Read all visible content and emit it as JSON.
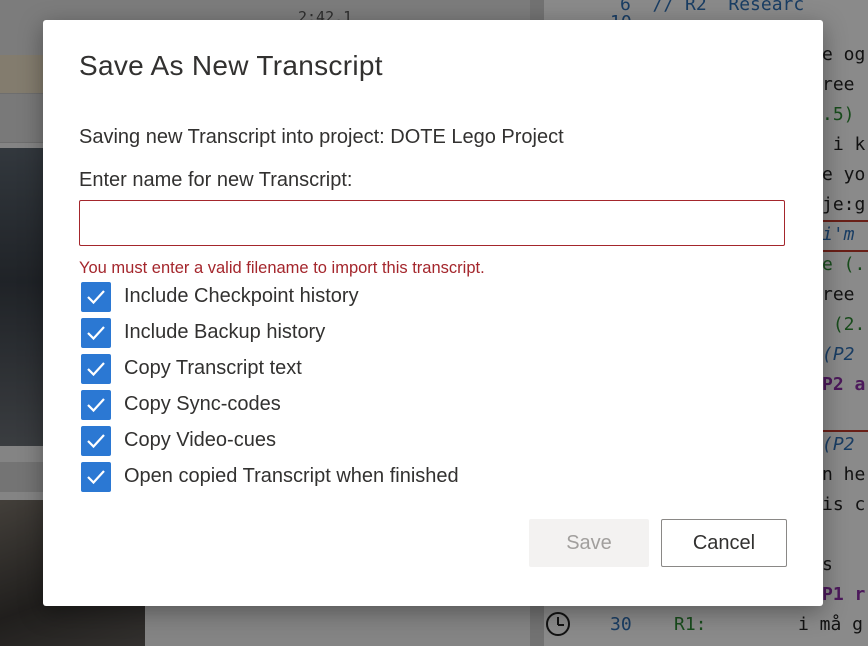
{
  "background": {
    "timestamp": "2:42.1",
    "editor_lines": [
      {
        "text": "6  // R2  Researc",
        "kind": "linenum"
      },
      {
        "text": "10",
        "kind": "linenum"
      },
      {
        "text": "e og",
        "kind": "plain"
      },
      {
        "text": "ree ",
        "kind": "plain"
      },
      {
        "text": ".5)",
        "kind": "green"
      },
      {
        "text": " i k",
        "kind": "plain"
      },
      {
        "text": "e yo",
        "kind": "plain"
      },
      {
        "text": "je:g",
        "kind": "plain"
      },
      {
        "text": "i'm ",
        "kind": "blue"
      },
      {
        "text": "e (.",
        "kind": "green"
      },
      {
        "text": "ree ",
        "kind": "plain"
      },
      {
        "text": " (2.",
        "kind": "green"
      },
      {
        "text": "(P2 ",
        "kind": "blue"
      },
      {
        "text": "P2 a",
        "kind": "purple"
      },
      {
        "text": "(P2 ",
        "kind": "blue"
      },
      {
        "text": "n he",
        "kind": "plain"
      },
      {
        "text": "is c",
        "kind": "plain"
      },
      {
        "text": "s",
        "kind": "plain"
      },
      {
        "text": "P1 r",
        "kind": "purple"
      }
    ],
    "bottom_line": {
      "number": "30",
      "speaker": "R1:",
      "text": "i må g"
    }
  },
  "dialog": {
    "title": "Save As New Transcript",
    "subtitle": "Saving new Transcript into project: DOTE Lego Project",
    "name_label": "Enter name for new Transcript:",
    "name_value": "",
    "name_placeholder": "",
    "error": "You must enter a valid filename to import this transcript.",
    "options": [
      {
        "label": "Include Checkpoint history",
        "checked": true
      },
      {
        "label": "Include Backup history",
        "checked": true
      },
      {
        "label": "Copy Transcript text",
        "checked": true
      },
      {
        "label": "Copy Sync-codes",
        "checked": true
      },
      {
        "label": "Copy Video-cues",
        "checked": true
      },
      {
        "label": "Open copied Transcript when finished",
        "checked": true
      }
    ],
    "save_label": "Save",
    "cancel_label": "Cancel"
  },
  "colors": {
    "accent": "#2b78d3",
    "error": "#a4262c",
    "text": "#323130",
    "disabled_text": "#a19f9d"
  }
}
